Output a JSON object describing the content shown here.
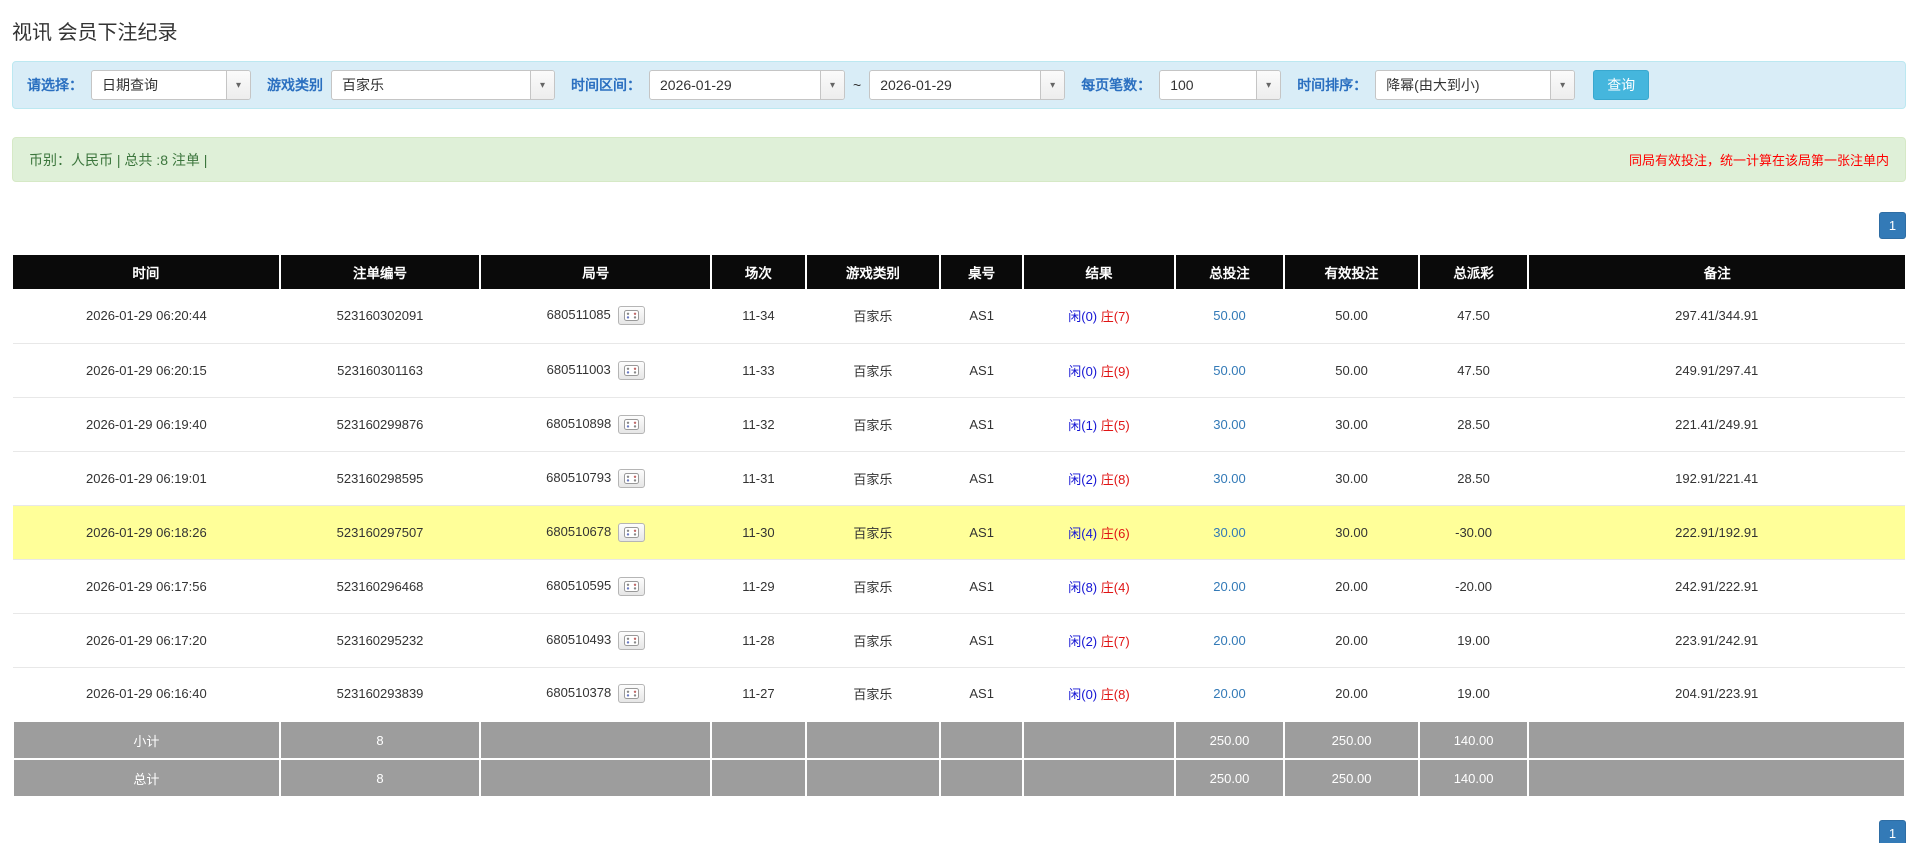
{
  "page": {
    "title": "视讯 会员下注纪录"
  },
  "icons": {
    "chevron_down": "▾"
  },
  "filters": {
    "select_label": "请选择：",
    "select_value": "日期查询",
    "game_type_label": "游戏类别",
    "game_type_value": "百家乐",
    "time_range_label": "时间区间：",
    "date_from": "2026-01-29",
    "tilde": "~",
    "date_to": "2026-01-29",
    "per_page_label": "每页笔数：",
    "per_page_value": "100",
    "sort_label": "时间排序：",
    "sort_value": "降幂(由大到小)",
    "search_button": "查询"
  },
  "info_bar": {
    "summary": "币别：人民币 | 总共 :8 注单 |",
    "notice": "同局有效投注，统一计算在该局第一张注单内"
  },
  "pagination": {
    "page": "1"
  },
  "table": {
    "headers": [
      "时间",
      "注单编号",
      "局号",
      "场次",
      "游戏类别",
      "桌号",
      "结果",
      "总投注",
      "有效投注",
      "总派彩",
      "备注"
    ],
    "rows": [
      {
        "time": "2026-01-29 06:20:44",
        "bet_id": "523160302091",
        "round_id": "680511085",
        "session": "11-34",
        "game": "百家乐",
        "table_no": "AS1",
        "result_player": "闲(0)",
        "result_banker": "庄(7)",
        "total_bet": "50.00",
        "valid_bet": "50.00",
        "payout": "47.50",
        "payout_negative": false,
        "remark": "297.41/344.91",
        "highlight": false
      },
      {
        "time": "2026-01-29 06:20:15",
        "bet_id": "523160301163",
        "round_id": "680511003",
        "session": "11-33",
        "game": "百家乐",
        "table_no": "AS1",
        "result_player": "闲(0)",
        "result_banker": "庄(9)",
        "total_bet": "50.00",
        "valid_bet": "50.00",
        "payout": "47.50",
        "payout_negative": false,
        "remark": "249.91/297.41",
        "highlight": false
      },
      {
        "time": "2026-01-29 06:19:40",
        "bet_id": "523160299876",
        "round_id": "680510898",
        "session": "11-32",
        "game": "百家乐",
        "table_no": "AS1",
        "result_player": "闲(1)",
        "result_banker": "庄(5)",
        "total_bet": "30.00",
        "valid_bet": "30.00",
        "payout": "28.50",
        "payout_negative": false,
        "remark": "221.41/249.91",
        "highlight": false
      },
      {
        "time": "2026-01-29 06:19:01",
        "bet_id": "523160298595",
        "round_id": "680510793",
        "session": "11-31",
        "game": "百家乐",
        "table_no": "AS1",
        "result_player": "闲(2)",
        "result_banker": "庄(8)",
        "total_bet": "30.00",
        "valid_bet": "30.00",
        "payout": "28.50",
        "payout_negative": false,
        "remark": "192.91/221.41",
        "highlight": false
      },
      {
        "time": "2026-01-29 06:18:26",
        "bet_id": "523160297507",
        "round_id": "680510678",
        "session": "11-30",
        "game": "百家乐",
        "table_no": "AS1",
        "result_player": "闲(4)",
        "result_banker": "庄(6)",
        "total_bet": "30.00",
        "valid_bet": "30.00",
        "payout": "-30.00",
        "payout_negative": true,
        "remark": "222.91/192.91",
        "highlight": true
      },
      {
        "time": "2026-01-29 06:17:56",
        "bet_id": "523160296468",
        "round_id": "680510595",
        "session": "11-29",
        "game": "百家乐",
        "table_no": "AS1",
        "result_player": "闲(8)",
        "result_banker": "庄(4)",
        "total_bet": "20.00",
        "valid_bet": "20.00",
        "payout": "-20.00",
        "payout_negative": true,
        "remark": "242.91/222.91",
        "highlight": false
      },
      {
        "time": "2026-01-29 06:17:20",
        "bet_id": "523160295232",
        "round_id": "680510493",
        "session": "11-28",
        "game": "百家乐",
        "table_no": "AS1",
        "result_player": "闲(2)",
        "result_banker": "庄(7)",
        "total_bet": "20.00",
        "valid_bet": "20.00",
        "payout": "19.00",
        "payout_negative": false,
        "remark": "223.91/242.91",
        "highlight": false
      },
      {
        "time": "2026-01-29 06:16:40",
        "bet_id": "523160293839",
        "round_id": "680510378",
        "session": "11-27",
        "game": "百家乐",
        "table_no": "AS1",
        "result_player": "闲(0)",
        "result_banker": "庄(8)",
        "total_bet": "20.00",
        "valid_bet": "20.00",
        "payout": "19.00",
        "payout_negative": false,
        "remark": "204.91/223.91",
        "highlight": false
      }
    ],
    "subtotal": {
      "label": "小计",
      "count": "8",
      "total_bet": "250.00",
      "valid_bet": "250.00",
      "payout": "140.00"
    },
    "total": {
      "label": "总计",
      "count": "8",
      "total_bet": "250.00",
      "valid_bet": "250.00",
      "payout": "140.00"
    }
  }
}
